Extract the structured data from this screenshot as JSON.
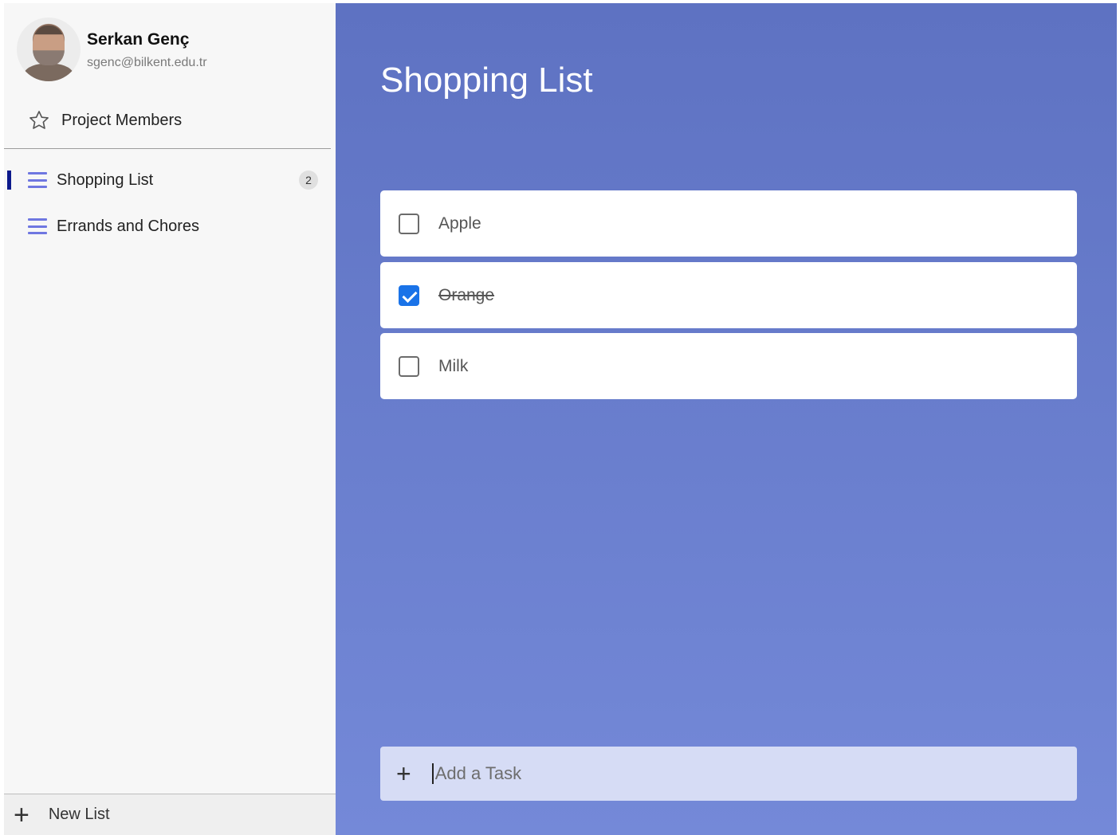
{
  "user": {
    "name": "Serkan Genç",
    "email": "sgenc@bilkent.edu.tr"
  },
  "sidebar": {
    "project_members_label": "Project Members",
    "lists": [
      {
        "label": "Shopping List",
        "count": "2",
        "active": true
      },
      {
        "label": "Errands and Chores",
        "count": "",
        "active": false
      }
    ],
    "new_list_label": "New List"
  },
  "main": {
    "title": "Shopping List",
    "tasks": [
      {
        "label": "Apple",
        "done": false
      },
      {
        "label": "Orange",
        "done": true
      },
      {
        "label": "Milk",
        "done": false
      }
    ],
    "add_task_placeholder": "Add a Task"
  },
  "colors": {
    "accent": "#5e72c2",
    "checkbox_checked": "#1a73e8",
    "active_marker": "#0c1a8c",
    "list_icon": "#6f77e1"
  }
}
